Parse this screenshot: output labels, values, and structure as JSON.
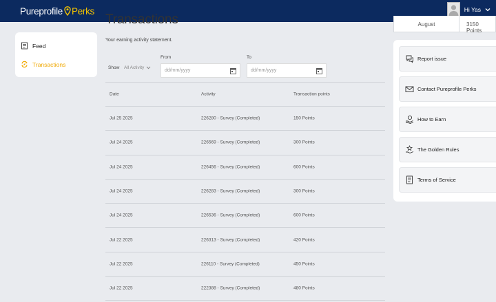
{
  "header": {
    "brand_main": "Pureprofile",
    "brand_accent": "Perks",
    "greeting": "Hi Yas",
    "colors": {
      "bar": "#0c2a5f",
      "accent": "#f5c400"
    }
  },
  "sidebar": {
    "items": [
      {
        "label": "Feed",
        "icon": "feed-icon",
        "active": false
      },
      {
        "label": "Transactions",
        "icon": "transactions-icon",
        "active": true
      }
    ]
  },
  "main": {
    "title": "Transactions",
    "subtitle": "Your earning activity statement.",
    "filter": {
      "show_label": "Show",
      "selected": "All Activity",
      "from_label": "From",
      "to_label": "To",
      "from_placeholder": "dd/mm/yyyy",
      "to_placeholder": "dd/mm/yyyy"
    },
    "table": {
      "headers": [
        "Date",
        "Activity",
        "Transaction points"
      ],
      "rows": [
        [
          "Jul 25 2025",
          "226280 - Survey (Completed)",
          "150 Points"
        ],
        [
          "Jul 24 2025",
          "226569 - Survey (Completed)",
          "300 Points"
        ],
        [
          "Jul 24 2025",
          "226456 - Survey (Completed)",
          "600 Points"
        ],
        [
          "Jul 24 2025",
          "226283 - Survey (Completed)",
          "300 Points"
        ],
        [
          "Jul 24 2025",
          "226536 - Survey (Completed)",
          "600 Points"
        ],
        [
          "Jul 22 2025",
          "226313 - Survey (Completed)",
          "420 Points"
        ],
        [
          "Jul 22 2025",
          "226110 - Survey (Completed)",
          "450 Points"
        ],
        [
          "Jul 22 2025",
          "222388 - Survey (Completed)",
          "480 Points"
        ]
      ]
    }
  },
  "balance": {
    "month": "August",
    "points": "3150 Points"
  },
  "help_links": [
    {
      "label": "Report issue",
      "icon": "chat-icon"
    },
    {
      "label": "Contact Pureprofile Perks",
      "icon": "mail-icon"
    },
    {
      "label": "How to Earn",
      "icon": "coin-hand-icon"
    },
    {
      "label": "The Golden Rules",
      "icon": "star-hand-icon"
    },
    {
      "label": "Terms of Service",
      "icon": "document-icon"
    }
  ]
}
